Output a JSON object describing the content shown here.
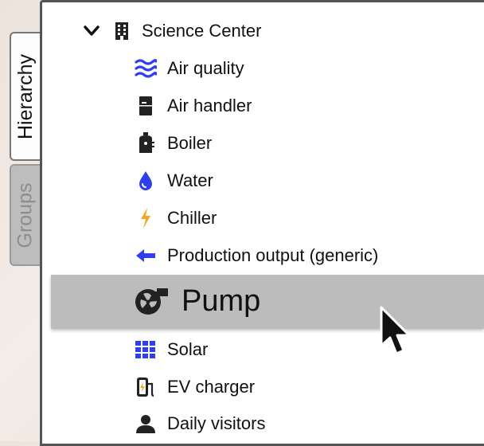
{
  "tabs": {
    "hierarchy_label": "Hierarchy",
    "groups_label": "Groups"
  },
  "tree": {
    "root_label": "Science Center",
    "items": [
      {
        "label": "Air quality",
        "icon": "waves-icon"
      },
      {
        "label": "Air handler",
        "icon": "air-handler-icon"
      },
      {
        "label": "Boiler",
        "icon": "boiler-icon"
      },
      {
        "label": "Water",
        "icon": "water-drop-icon"
      },
      {
        "label": "Chiller",
        "icon": "lightning-icon"
      },
      {
        "label": "Production output (generic)",
        "icon": "arrow-left-icon"
      },
      {
        "label": "Pump",
        "icon": "pump-icon"
      },
      {
        "label": "Solar",
        "icon": "solar-grid-icon"
      },
      {
        "label": "EV charger",
        "icon": "ev-charger-icon"
      },
      {
        "label": "Daily visitors",
        "icon": "person-icon"
      }
    ]
  },
  "colors": {
    "accent_blue": "#2f3ff0",
    "chiller_orange": "#f5a623",
    "selection_gray": "#bcbcbc",
    "icon_dark": "#222222"
  }
}
